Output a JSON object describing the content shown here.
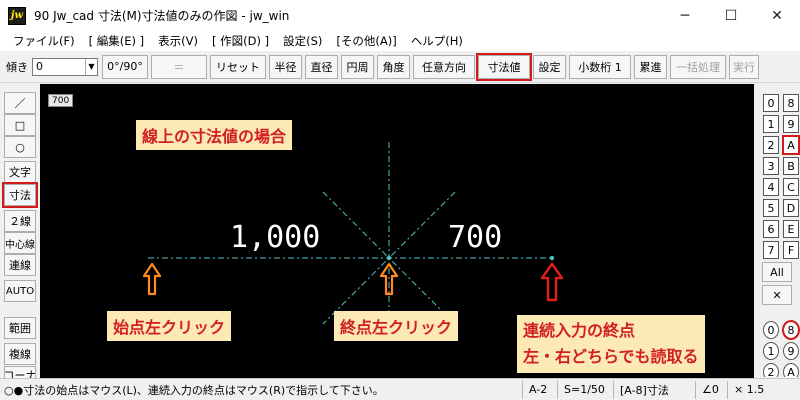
{
  "window": {
    "title": "90 Jw_cad 寸法(M)寸法値のみの作図 - jw_win",
    "app_icon_text": "jw",
    "minimize": "─",
    "maximize": "☐",
    "close": "✕"
  },
  "menu": [
    "ファイル(F)",
    "[ 編集(E) ]",
    "表示(V)",
    "[ 作図(D) ]",
    "設定(S)",
    "[その他(A)]",
    "ヘルプ(H)"
  ],
  "toolbar": {
    "angle_label": "傾き",
    "angle_value": "0",
    "angle_toggle": "0°/90°",
    "equals": "＝",
    "reset": "リセット",
    "radius": "半径",
    "diameter": "直径",
    "circumference": "円周",
    "angle": "角度",
    "any_direction": "任意方向",
    "dim_value": "寸法値",
    "settings": "設定",
    "decimals": "小数桁 1",
    "cumulative": "累進",
    "batch": "一括処理",
    "execute": "実行"
  },
  "left_tools": {
    "line": "／",
    "rect": "□",
    "circle": "○",
    "text": "文字",
    "dimension": "寸法",
    "double_line": "２線",
    "center_line": "中心線",
    "continuous": "連線",
    "auto": "AUTO",
    "range": "範囲",
    "copy": "複線",
    "corner": "コーナ"
  },
  "canvas": {
    "scale_badge": "700",
    "heading": "線上の寸法値の場合",
    "dim_left": "1,000",
    "dim_right": "700",
    "label_start": "始点左クリック",
    "label_end": "終点左クリック",
    "label_cont_1": "連続入力の終点",
    "label_cont_2": "左・右どちらでも読取る",
    "colors": {
      "callout_bg": "#fde9b4",
      "callout_text": "#d12020",
      "orange_arrow": "#ff8a1f",
      "red_arrow": "#e0201d",
      "line": "#4fc3c3"
    }
  },
  "layers": {
    "left": [
      "0",
      "1",
      "2",
      "3",
      "4",
      "5",
      "6",
      "7"
    ],
    "right": [
      "8",
      "9",
      "A",
      "B",
      "C",
      "D",
      "E",
      "F"
    ],
    "all": "All",
    "cross": "✕",
    "group_left": [
      "0",
      "1",
      "2"
    ],
    "group_right": [
      "8",
      "9",
      "A"
    ]
  },
  "status": {
    "message": "○●寸法の始点はマウス(L)、連続入力の終点はマウス(R)で指示して下さい。",
    "paper": "A-2",
    "scale": "S=1/50",
    "layer": "[A-8]寸法",
    "angle": "∠0",
    "factor": "× 1.5"
  }
}
